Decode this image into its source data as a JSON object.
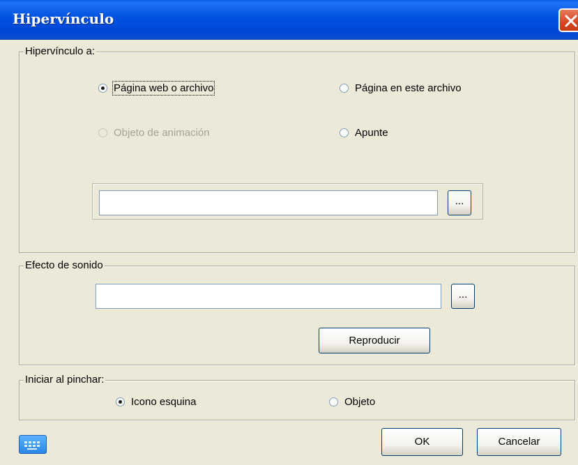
{
  "dialog": {
    "title": "Hipervínculo"
  },
  "hyperlink_group": {
    "legend": "Hipervínculo a:",
    "options": {
      "web_page": {
        "label": "Página web o archivo",
        "checked": true
      },
      "page_in_file": {
        "label": "Página en este archivo",
        "checked": false
      },
      "animation_object": {
        "label": "Objeto de animación",
        "checked": false,
        "disabled": true
      },
      "note": {
        "label": "Apunte",
        "checked": false
      }
    },
    "path_value": "",
    "browse_label": "..."
  },
  "sound_group": {
    "legend": "Efecto de sonido",
    "path_value": "",
    "browse_label": "...",
    "play_label": "Reproducir"
  },
  "start_group": {
    "legend": "Iniciar al pinchar:",
    "options": {
      "corner_icon": {
        "label": "Icono esquina",
        "checked": true
      },
      "object": {
        "label": "Objeto",
        "checked": false
      }
    }
  },
  "footer": {
    "ok_label": "OK",
    "cancel_label": "Cancelar",
    "keyboard_icon": "keyboard-icon"
  }
}
